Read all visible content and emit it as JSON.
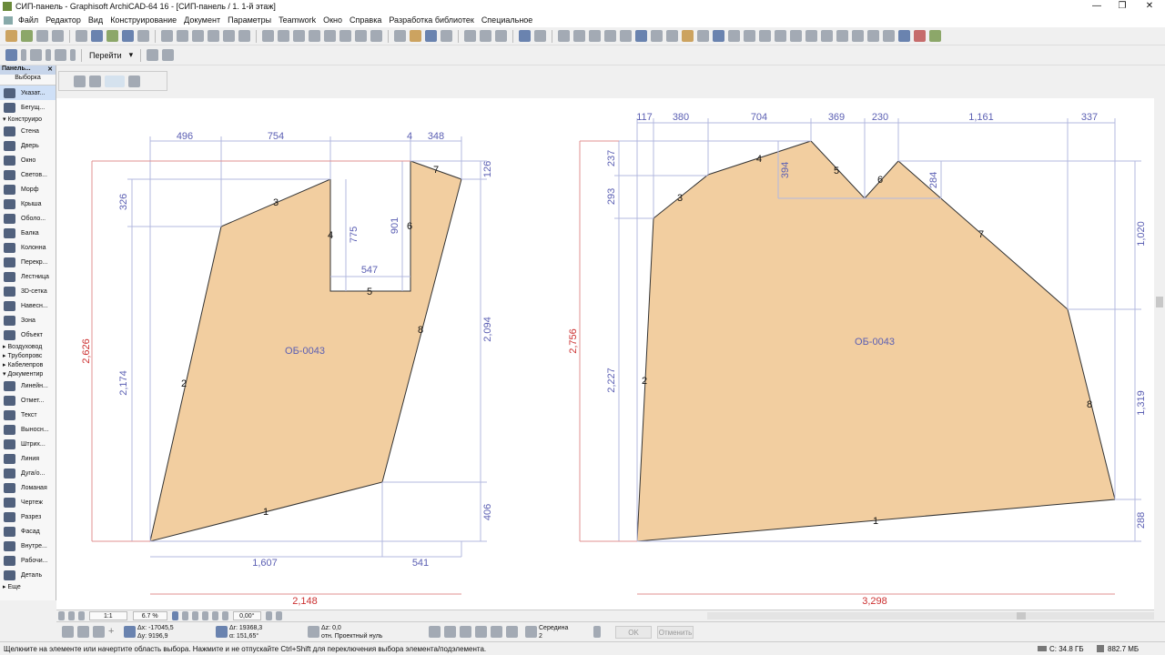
{
  "window": {
    "title": "СИП-панель - Graphisoft ArchiCAD-64 16 - [СИП-панель / 1. 1-й этаж]",
    "min": "—",
    "max": "❐",
    "close": "✕"
  },
  "menu": [
    "Файл",
    "Редактор",
    "Вид",
    "Конструирование",
    "Документ",
    "Параметры",
    "Teamwork",
    "Окно",
    "Справка",
    "Разработка библиотек",
    "Специальное"
  ],
  "toolbar2": {
    "goto": "Перейти"
  },
  "palette": {
    "title": "Панель...",
    "selection": "Выборка",
    "items": [
      "Указат...",
      "Бегущ..."
    ],
    "section_design": "Конструиро",
    "design": [
      "Стена",
      "Дверь",
      "Окно",
      "Светов...",
      "Морф",
      "Крыша",
      "Оболо...",
      "Балка",
      "Колонна",
      "Перекр...",
      "Лестница",
      "3D-сетка",
      "Навесн...",
      "Зона",
      "Объект"
    ],
    "groups": [
      "Воздуховод",
      "Трубопровс",
      "Кабелепров"
    ],
    "section_doc": "Документир",
    "doc": [
      "Линейн...",
      "Отмет...",
      "Текст",
      "Выносн...",
      "Штрих...",
      "Линия",
      "Дуга/о...",
      "Ломаная",
      "Чертеж",
      "Разрез",
      "Фасад",
      "Внутре...",
      "Рабочи...",
      "Деталь"
    ],
    "more": "Еще"
  },
  "left_drawing": {
    "id_label": "ОБ-0043",
    "dims": [
      "496",
      "754",
      "4",
      "348",
      "326",
      "2,174",
      "2,626",
      "775",
      "901",
      "547",
      "126",
      "2,094",
      "406",
      "1,607",
      "541",
      "2,148"
    ],
    "edges": [
      "1",
      "2",
      "3",
      "4",
      "5",
      "6",
      "7",
      "8"
    ]
  },
  "right_drawing": {
    "id_label": "ОБ-0043",
    "dims": [
      "117",
      "380",
      "704",
      "369",
      "230",
      "1,161",
      "337",
      "237",
      "293",
      "2,227",
      "2,756",
      "394",
      "284",
      "1,020",
      "1,319",
      "288",
      "3,298"
    ],
    "edges": [
      "1",
      "2",
      "3",
      "4",
      "5",
      "6",
      "7",
      "8"
    ]
  },
  "navbar": {
    "scale": "1:1",
    "zoom": "6.7 %",
    "angle": "0,00°"
  },
  "coords": {
    "dx": "Δx: -17045,5",
    "dy": "Δy: 9196,9",
    "dr": "Δr: 19368,3",
    "angle": "α: 151,65°",
    "dz": "Δz: 0,0",
    "ref": "отн. Проектный нуль",
    "snap": "Середина",
    "snap_n": "2",
    "ok": "OK",
    "cancel": "Отменить"
  },
  "status": {
    "hint": "Щелкните на элементе или начертите область выбора. Нажмите и не отпускайте Ctrl+Shift для переключения выбора элемента/подэлемента.",
    "disk": "C: 34.8 ГБ",
    "mem": "882.7 МБ"
  },
  "colors": {
    "fill": "#f2cea0",
    "dim": "#5b5fb3",
    "overall": "#cc3030"
  }
}
